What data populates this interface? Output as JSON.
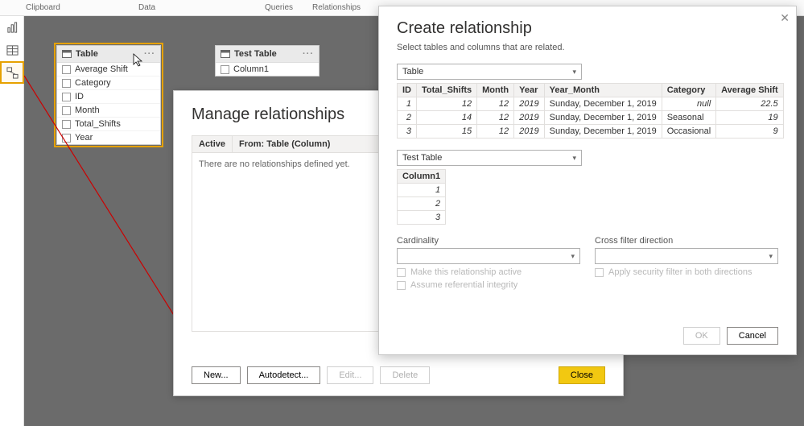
{
  "ribbon": {
    "clipboard": "Clipboard",
    "data": "Data",
    "queries": "Queries",
    "relationships": "Relationships"
  },
  "canvas_tables": {
    "table1": {
      "title": "Table",
      "fields": [
        "Average Shift",
        "Category",
        "ID",
        "Month",
        "Total_Shifts",
        "Year"
      ]
    },
    "table2": {
      "title": "Test Table",
      "fields": [
        "Column1"
      ]
    }
  },
  "manage": {
    "title": "Manage relationships",
    "col_active": "Active",
    "col_from": "From: Table (Column)",
    "empty": "There are no relationships defined yet.",
    "new_btn": "New...",
    "auto_btn": "Autodetect...",
    "edit_btn": "Edit...",
    "del_btn": "Delete",
    "close_btn": "Close"
  },
  "create": {
    "title": "Create relationship",
    "subtitle": "Select tables and columns that are related.",
    "dd1": "Table",
    "dd2": "Test Table",
    "t1": {
      "cols": [
        "ID",
        "Total_Shifts",
        "Month",
        "Year",
        "Year_Month",
        "Category",
        "Average Shift"
      ],
      "rows": [
        [
          "1",
          "12",
          "12",
          "2019",
          "Sunday, December 1, 2019",
          "null",
          "22.5"
        ],
        [
          "2",
          "14",
          "12",
          "2019",
          "Sunday, December 1, 2019",
          "Seasonal",
          "19"
        ],
        [
          "3",
          "15",
          "12",
          "2019",
          "Sunday, December 1, 2019",
          "Occasional",
          "9"
        ]
      ]
    },
    "t2": {
      "col": "Column1",
      "rows": [
        "1",
        "2",
        "3"
      ]
    },
    "card_label": "Cardinality",
    "cfd_label": "Cross filter direction",
    "chk_active": "Make this relationship active",
    "chk_sec": "Apply security filter in both directions",
    "chk_ref": "Assume referential integrity",
    "ok": "OK",
    "cancel": "Cancel"
  }
}
